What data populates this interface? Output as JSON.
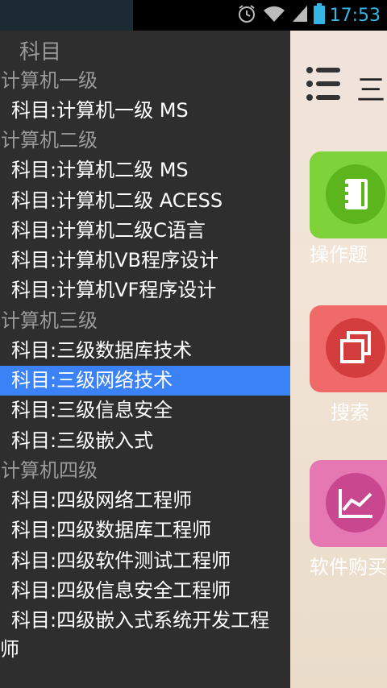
{
  "status_bar": {
    "time": "17:53",
    "icons": [
      "alarm-icon",
      "wifi-icon",
      "signal-icon",
      "battery-icon"
    ],
    "time_color": "#33b5e5"
  },
  "drawer": {
    "title": "科目",
    "groups": [
      {
        "header": "计算机一级",
        "items": [
          "科目:计算机一级 MS"
        ]
      },
      {
        "header": "计算机二级",
        "items": [
          "科目:计算机二级 MS",
          "科目:计算机二级 ACESS",
          "科目:计算机二级C语言",
          "科目:计算机VB程序设计",
          "科目:计算机VF程序设计"
        ]
      },
      {
        "header": "计算机三级",
        "items": [
          "科目:三级数据库技术",
          "科目:三级网络技术",
          "科目:三级信息安全",
          "科目:三级嵌入式"
        ]
      },
      {
        "header": "计算机四级",
        "items": [
          "科目:四级网络工程师",
          "科目:四级数据库工程师",
          "科目:四级软件测试工程师",
          "科目:四级信息安全工程师",
          "科目:四级嵌入式系统开发工程师"
        ]
      }
    ],
    "selected_item": "科目:三级网络技术",
    "selected_color": "#3b82f6"
  },
  "app": {
    "title_glyph": "三",
    "tiles": [
      {
        "label": "操作题",
        "icon": "notebook-icon",
        "color": "#7ed33b"
      },
      {
        "label": "搜索",
        "icon": "copy-windows-icon",
        "color": "#f06a6a"
      },
      {
        "label": "软件购买",
        "icon": "line-chart-icon",
        "color": "#e577b3"
      }
    ]
  }
}
